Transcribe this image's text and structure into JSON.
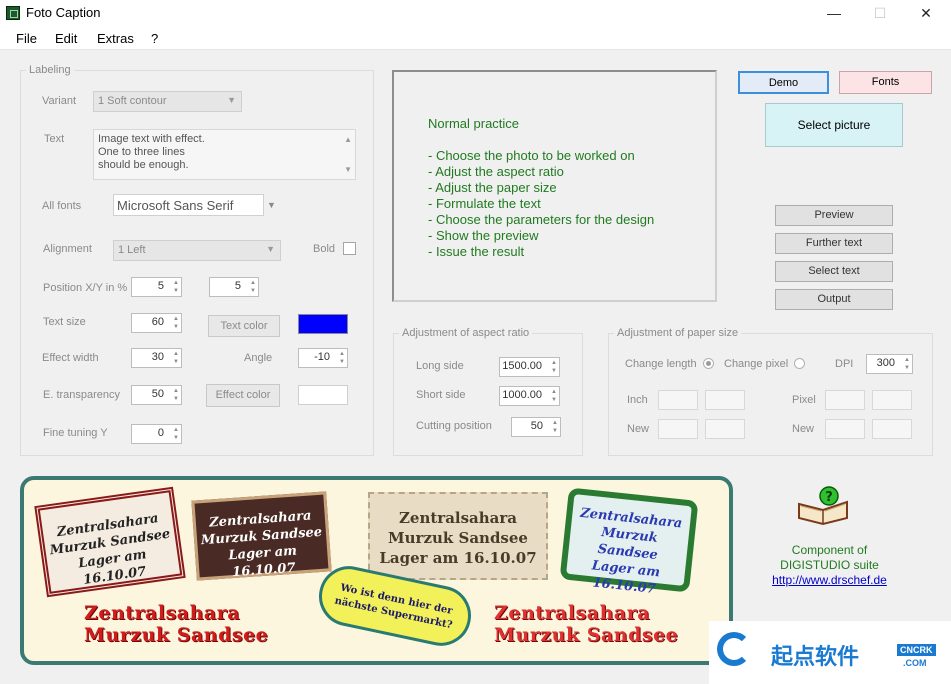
{
  "window": {
    "title": "Foto Caption",
    "minimize": "—",
    "maximize": "☐",
    "close": "✕"
  },
  "menu": [
    "File",
    "Edit",
    "Extras",
    "?"
  ],
  "labeling": {
    "legend": "Labeling",
    "variant_label": "Variant",
    "variant_value": "1 Soft contour",
    "text_label": "Text",
    "text_lines": [
      "Image text with effect.",
      "One to three lines",
      "should be enough."
    ],
    "allfonts_label": "All fonts",
    "font_value": "Microsoft Sans Serif",
    "alignment_label": "Alignment",
    "alignment_value": "1 Left",
    "bold_label": "Bold",
    "posxy_label": "Position X/Y in %",
    "pos_x": "5",
    "pos_y": "5",
    "textsize_label": "Text size",
    "textsize_value": "60",
    "textcolor_button": "Text color",
    "text_color": "#0000ff",
    "effectwidth_label": "Effect width",
    "effectwidth_value": "30",
    "angle_label": "Angle",
    "angle_value": "-10",
    "etrans_label": "E. transparency",
    "etrans_value": "50",
    "effectcolor_button": "Effect color",
    "effect_color": "#ffffff",
    "finetune_label": "Fine tuning Y",
    "finetune_value": "0"
  },
  "help": {
    "heading": "Normal practice",
    "steps": [
      "- Choose the photo to be worked on",
      "- Adjust the aspect ratio",
      "- Adjust the paper size",
      "- Formulate the text",
      "- Choose the parameters for the design",
      "- Show the preview",
      "- Issue the result"
    ]
  },
  "buttons": {
    "demo": "Demo",
    "fonts": "Fonts",
    "select_picture": "Select picture",
    "preview": "Preview",
    "further_text": "Further text",
    "select_text": "Select text",
    "output": "Output"
  },
  "aspect": {
    "legend": "Adjustment of aspect ratio",
    "long_label": "Long side",
    "long_value": "1500.00",
    "short_label": "Short side",
    "short_value": "1000.00",
    "cut_label": "Cutting position",
    "cut_value": "50"
  },
  "paper": {
    "legend": "Adjustment of paper size",
    "change_length": "Change length",
    "change_pixel": "Change pixel",
    "dpi_label": "DPI",
    "dpi_value": "300",
    "inch_label": "Inch",
    "pixel_label": "Pixel",
    "new_label": "New",
    "new_label2": "New"
  },
  "sample": {
    "tag1": [
      "Zentralsahara",
      "Murzuk Sandsee",
      "Lager am 16.10.07"
    ],
    "tag2": [
      "Zentralsahara",
      "Murzuk Sandsee",
      "Lager am 16.10.07"
    ],
    "tag3": [
      "Zentralsahara",
      "Murzuk Sandsee",
      "Lager am 16.10.07"
    ],
    "tag4": [
      "Zentralsahara",
      "Murzuk Sandsee",
      "Lager am 16.10.07"
    ],
    "red1": [
      "Zentralsahara",
      "Murzuk Sandsee"
    ],
    "red2": [
      "Zentralsahara",
      "Murzuk Sandsee"
    ],
    "bubble": [
      "Wo ist denn hier der",
      "nächste Supermarkt?"
    ]
  },
  "component": {
    "line1": "Component of",
    "line2": "DIGISTUDIO suite",
    "url": "http://www.drschef.de"
  },
  "watermark": {
    "cn": "起点软件",
    "brand": "CNCRK",
    "com": ".COM"
  }
}
